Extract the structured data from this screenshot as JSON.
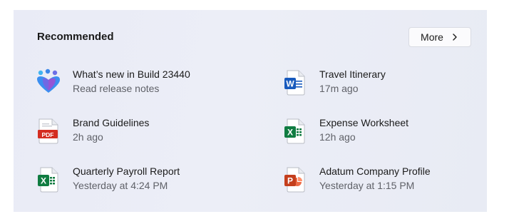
{
  "section": {
    "title": "Recommended",
    "more_label": "More"
  },
  "items": [
    {
      "name": "What’s new in Build 23440",
      "subtitle": "Read release notes",
      "icon": "tips-app-icon"
    },
    {
      "name": "Travel Itinerary",
      "subtitle": "17m ago",
      "icon": "word-document-icon"
    },
    {
      "name": "Brand Guidelines",
      "subtitle": "2h ago",
      "icon": "pdf-document-icon"
    },
    {
      "name": "Expense Worksheet",
      "subtitle": "12h ago",
      "icon": "excel-document-icon"
    },
    {
      "name": "Quarterly Payroll Report",
      "subtitle": "Yesterday at 4:24 PM",
      "icon": "excel-document-icon"
    },
    {
      "name": "Adatum Company Profile",
      "subtitle": "Yesterday at 1:15 PM",
      "icon": "powerpoint-document-icon"
    }
  ],
  "icon_labels": {
    "word": "W",
    "pdf": "PDF",
    "excel": "X",
    "powerpoint": "P"
  },
  "colors": {
    "word": "#185abd",
    "excel": "#107c41",
    "powerpoint": "#c43e1c",
    "pdf": "#d42d20"
  }
}
